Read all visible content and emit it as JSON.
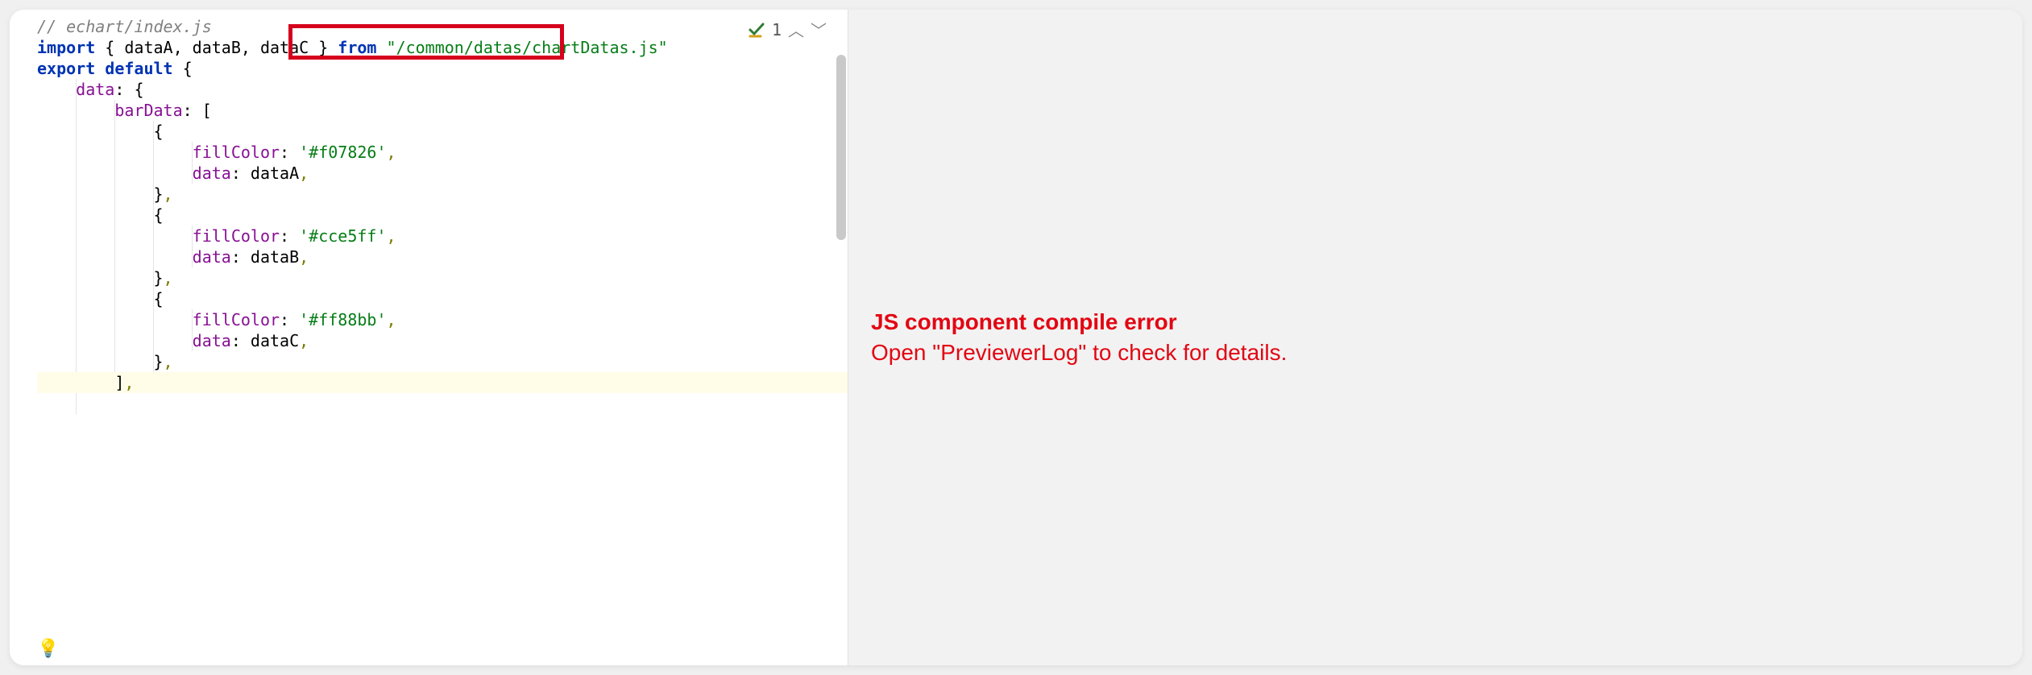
{
  "editor": {
    "comment": "// echart/index.js",
    "import_kw": "import",
    "import_names": "{ dataA, dataB, dataC }",
    "from_kw": "from",
    "import_path": "\"/common/datas/chartDatas.js\"",
    "export_kw": "export",
    "default_kw": "default",
    "data_key": "data",
    "barData_key": "barData",
    "fillColor_key": "fillColor",
    "data_inner_key": "data",
    "items": [
      {
        "color": "'#f07826'",
        "data": "dataA"
      },
      {
        "color": "'#cce5ff'",
        "data": "dataB"
      },
      {
        "color": "'#ff88bb'",
        "data": "dataC"
      }
    ],
    "open_brace": "{",
    "close_brace": "}",
    "open_bracket": "[",
    "close_bracket": "]",
    "colon": ":",
    "comma": ","
  },
  "status": {
    "warn_count": "1"
  },
  "preview": {
    "error_title": "JS component compile error",
    "error_sub": "Open \"PreviewerLog\" to check for details."
  }
}
